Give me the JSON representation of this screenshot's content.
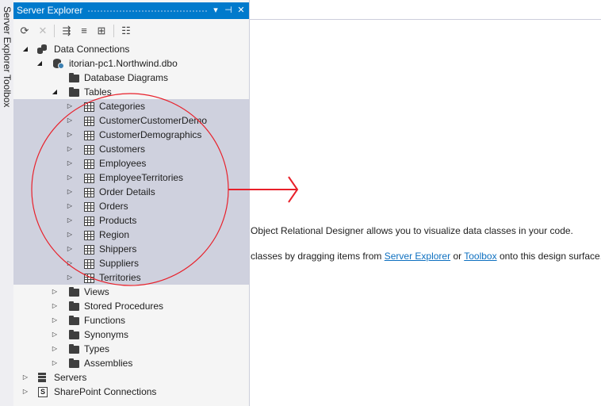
{
  "side_tabs": [
    "Server Explorer",
    "Toolbox"
  ],
  "panel": {
    "title": "Server Explorer",
    "header_buttons": {
      "dropdown": "▾",
      "pin": "⊣",
      "close": "✕"
    }
  },
  "toolbar": {
    "refresh": "⟳",
    "stop": "✕",
    "connect_database": "⇶",
    "connect_server": "≡",
    "connect_sharepoint": "⊞",
    "properties": "☷"
  },
  "tree": {
    "data_connections": "Data Connections",
    "database": "itorian-pc1.Northwind.dbo",
    "database_diagrams": "Database Diagrams",
    "tables": "Tables",
    "table_items": [
      "Categories",
      "CustomerCustomerDemo",
      "CustomerDemographics",
      "Customers",
      "Employees",
      "EmployeeTerritories",
      "Order Details",
      "Orders",
      "Products",
      "Region",
      "Shippers",
      "Suppliers",
      "Territories"
    ],
    "views": "Views",
    "stored_procedures": "Stored Procedures",
    "functions": "Functions",
    "synonyms": "Synonyms",
    "types": "Types",
    "assemblies": "Assemblies",
    "servers": "Servers",
    "sharepoint_connections": "SharePoint Connections"
  },
  "designer": {
    "line1": "Object Relational Designer allows you to visualize data classes in your code.",
    "line2_prefix": "classes by dragging items from ",
    "link_server_explorer": "Server Explorer",
    "line2_or": " or ",
    "link_toolbox": "Toolbox",
    "line2_suffix": " onto this design surface."
  },
  "colors": {
    "panel_header": "#007acc",
    "selection": "#cfd1de",
    "annotation": "#e8202a",
    "link": "#0e70c0"
  }
}
